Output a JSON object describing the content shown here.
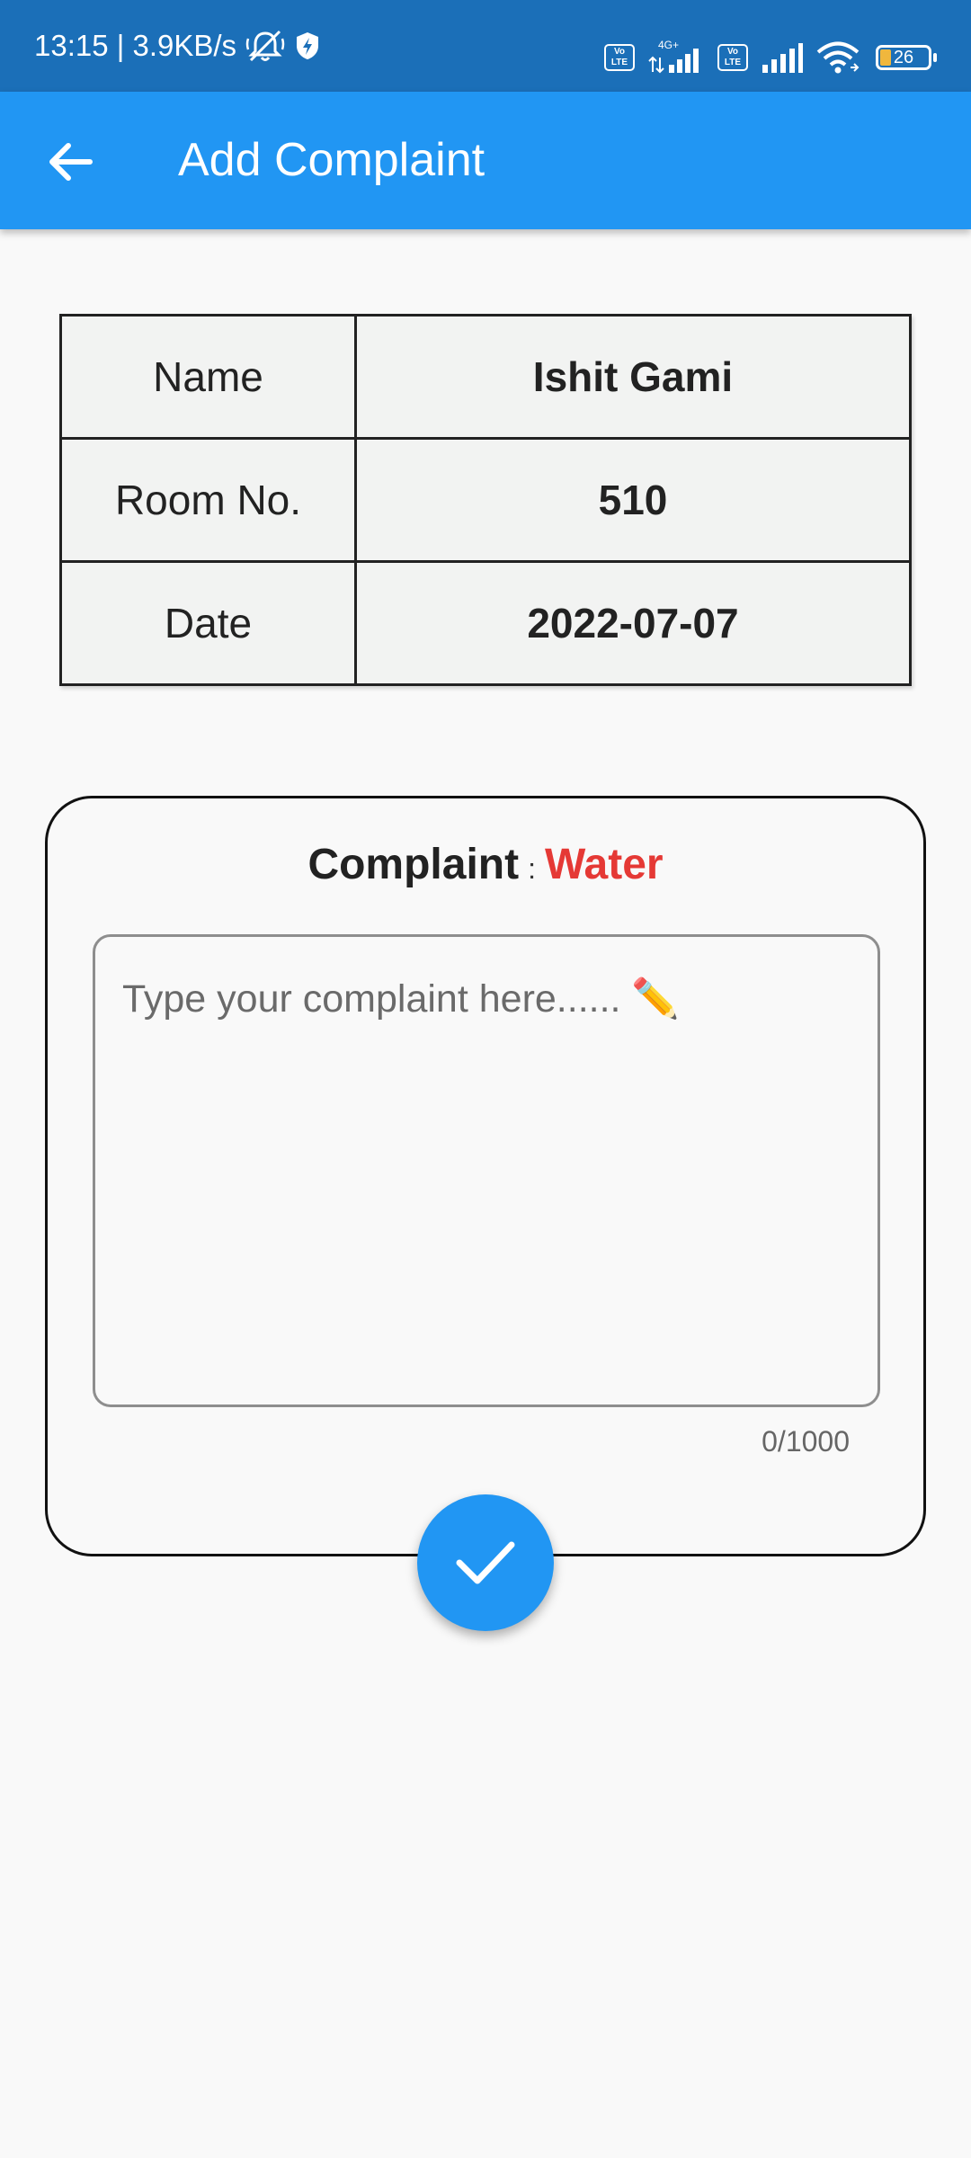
{
  "status_bar": {
    "time_speed": "13:15 | 3.9KB/s",
    "network_label": "4G+",
    "volte_label": "Vo LTE",
    "battery": "26"
  },
  "app_bar": {
    "title": "Add Complaint"
  },
  "info_table": {
    "rows": [
      {
        "label": "Name",
        "value": "Ishit Gami"
      },
      {
        "label": "Room No.",
        "value": "510"
      },
      {
        "label": "Date",
        "value": "2022-07-07"
      }
    ]
  },
  "complaint": {
    "label": "Complaint",
    "separator": ":",
    "type": "Water",
    "input_value": "",
    "placeholder": "Type your complaint here...... ✏️",
    "counter": "0/1000"
  },
  "colors": {
    "app_bar": "#2196f3",
    "status_bar": "#1b6fb8",
    "complaint_type": "#e53935"
  },
  "icons": {
    "back": "arrow-left-icon",
    "submit": "check-icon"
  }
}
